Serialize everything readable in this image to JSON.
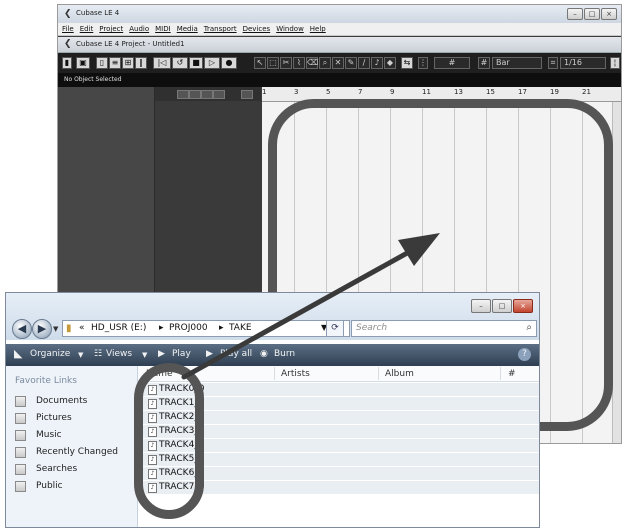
{
  "cubase": {
    "title": "Cubase LE 4",
    "menu": [
      "File",
      "Edit",
      "Project",
      "Audio",
      "MIDI",
      "Media",
      "Transport",
      "Devices",
      "Window",
      "Help"
    ],
    "project_title": "Cubase LE 4 Project - Untitled1",
    "info_line": "No Object Selected",
    "toolbar": {
      "grid_type": "Bar",
      "quantize": "1/16"
    },
    "ruler_ticks": [
      "1",
      "3",
      "5",
      "7",
      "9",
      "11",
      "13",
      "15",
      "17",
      "19",
      "21"
    ],
    "window_buttons": [
      "–",
      "□",
      "×"
    ]
  },
  "explorer": {
    "window_buttons": [
      "–",
      "□",
      "×"
    ],
    "address": {
      "prefix": "«",
      "parts": [
        "HD_USR (E:)",
        "PROJ000",
        "TAKE"
      ]
    },
    "search_placeholder": "Search",
    "commands": {
      "organize": "Organize",
      "views": "Views",
      "play": "Play",
      "play_all": "Play all",
      "burn": "Burn"
    },
    "nav": {
      "header": "Favorite Links",
      "items": [
        "Documents",
        "Pictures",
        "Music",
        "Recently Changed",
        "Searches",
        "Public"
      ]
    },
    "columns": {
      "name": "Name",
      "artists": "Artists",
      "album": "Album",
      "number": "#"
    },
    "files": [
      "TRACK0_0",
      "TRACK1_0",
      "TRACK2_0",
      "TRACK3_0",
      "TRACK4_0",
      "TRACK5_0",
      "TRACK6_0",
      "TRACK7_0"
    ]
  },
  "annotation_colors": {
    "highlight": "#555555",
    "arrow": "#3a3a3a"
  }
}
